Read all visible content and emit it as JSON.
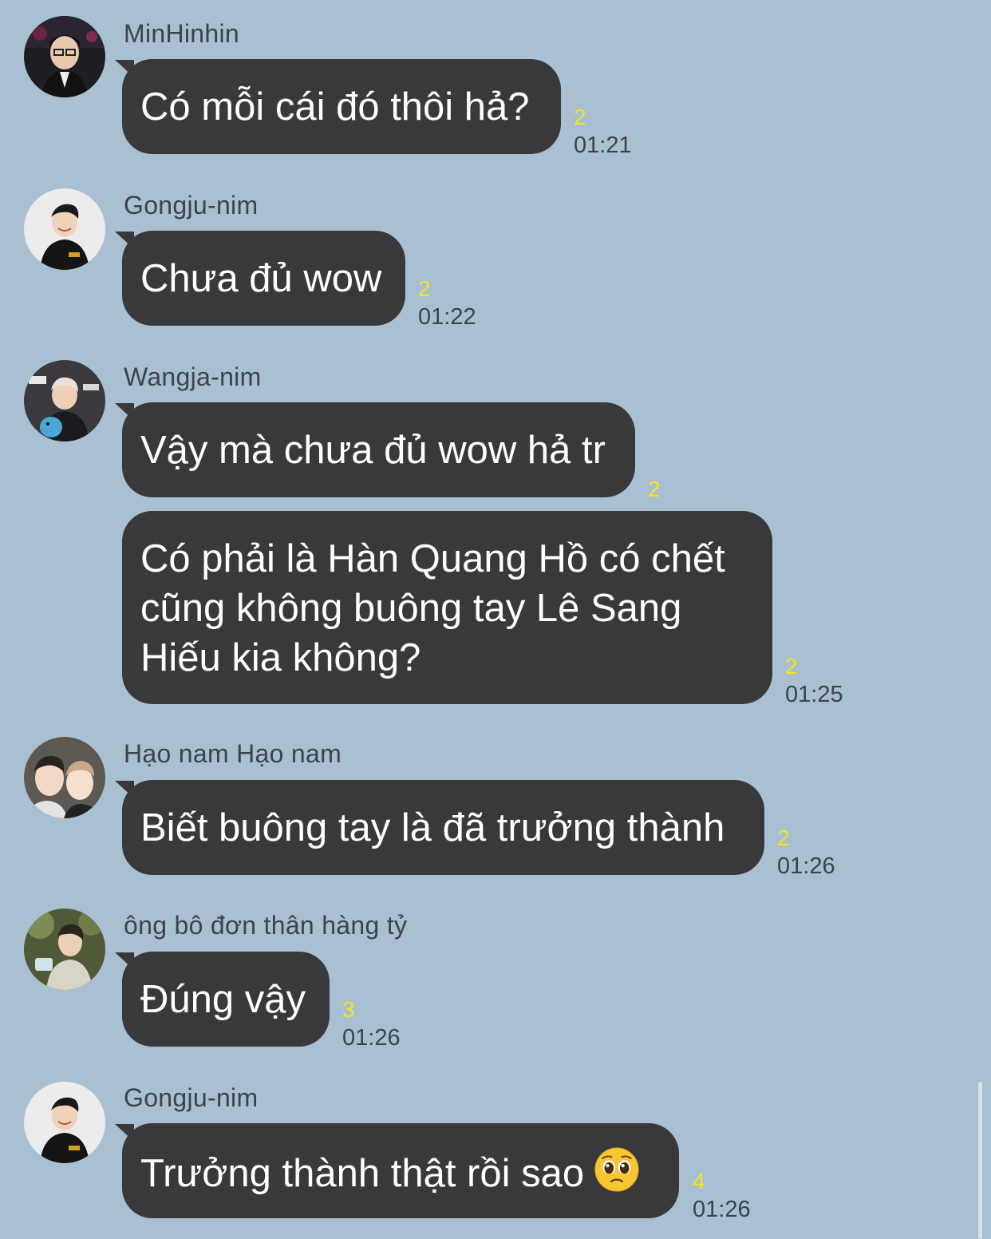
{
  "messages": [
    {
      "sender": "MinHinhin",
      "text": "Có mỗi cái đó thôi hả?",
      "unread": "2",
      "time": "01:21"
    },
    {
      "sender": "Gongju-nim",
      "text": "Chưa đủ wow",
      "unread": "2",
      "time": "01:22"
    },
    {
      "sender": "Wangja-nim",
      "text": "Vậy mà chưa đủ wow hả tr",
      "unread": "2",
      "time": ""
    },
    {
      "sender": "",
      "text": "Có phải là Hàn Quang Hồ có chết\ncũng không buông tay Lê Sang\nHiếu kia không?",
      "unread": "2",
      "time": "01:25"
    },
    {
      "sender": "Hạo nam Hạo nam",
      "text": "Biết buông tay là đã trưởng thành",
      "unread": "2",
      "time": "01:26"
    },
    {
      "sender": "ông bô đơn thân hàng tỷ",
      "text": "Đúng vậy",
      "unread": "3",
      "time": "01:26"
    },
    {
      "sender": "Gongju-nim",
      "text": "Trưởng thành thật rồi sao",
      "emoji": "pleading-face",
      "unread": "4",
      "time": "01:26"
    }
  ],
  "colors": {
    "background": "#a9bfd2",
    "bubble": "#39393c",
    "unread": "#f5e61a",
    "meta_text": "#3b444d"
  }
}
